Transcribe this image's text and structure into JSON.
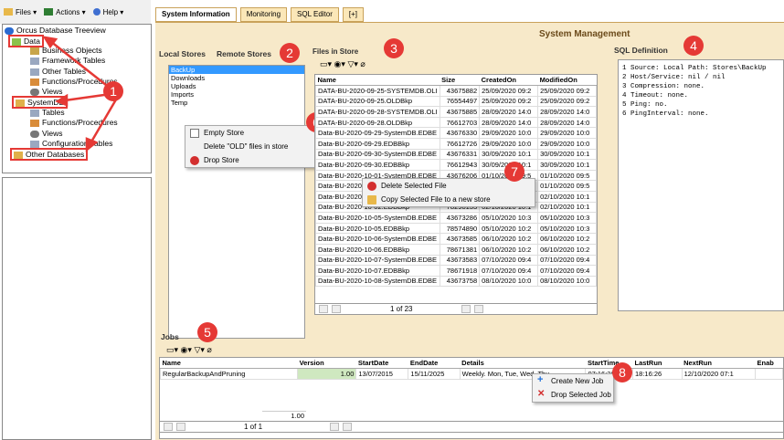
{
  "toolbar": {
    "files": "Files",
    "actions": "Actions",
    "help": "Help"
  },
  "tree": {
    "root": "Orcus Database Treeview",
    "items": [
      "Data",
      "Business Objects",
      "Framework Tables",
      "Other Tables",
      "Functions/Procedures",
      "Views",
      "SystemDB",
      "Tables",
      "Functions/Procedures",
      "Views",
      "Configuration Tables",
      "Other Databases"
    ]
  },
  "tabs": [
    "System Information",
    "Monitoring",
    "SQL Editor",
    "[+]"
  ],
  "title": "System Management",
  "stores": {
    "local_tab": "Local Stores",
    "remote_tab": "Remote Stores",
    "items": [
      "BackUp",
      "Downloads",
      "Uploads",
      "Imports",
      "Temp"
    ]
  },
  "store_menu": [
    "Empty Store",
    "Delete \"OLD\" files in store",
    "Drop Store"
  ],
  "files": {
    "title": "Files in Store",
    "headers": [
      "Name",
      "Size",
      "CreatedOn",
      "ModifiedOn"
    ],
    "rows": [
      [
        "DATA-BU-2020-09-25-SYSTEMDB.OLI",
        "43675882",
        "25/09/2020 09:2",
        "25/09/2020 09:2"
      ],
      [
        "DATA-BU-2020-09-25.OLDBkp",
        "76554497",
        "25/09/2020 09:2",
        "25/09/2020 09:2"
      ],
      [
        "DATA-BU-2020-09-28-SYSTEMDB.OLI",
        "43675885",
        "28/09/2020 14:0",
        "28/09/2020 14:0"
      ],
      [
        "DATA-BU-2020-09-28.OLDBkp",
        "76612703",
        "28/09/2020 14:0",
        "28/09/2020 14:0"
      ],
      [
        "Data-BU-2020-09-29-SystemDB.EDBE",
        "43676330",
        "29/09/2020 10:0",
        "29/09/2020 10:0"
      ],
      [
        "Data-BU-2020-09-29.EDBBkp",
        "76612726",
        "29/09/2020 10:0",
        "29/09/2020 10:0"
      ],
      [
        "Data-BU-2020-09-30-SystemDB.EDBE",
        "43676331",
        "30/09/2020 10:1",
        "30/09/2020 10:1"
      ],
      [
        "Data-BU-2020-09-30.EDBBkp",
        "76612943",
        "30/09/2020 10:1",
        "30/09/2020 10:1"
      ],
      [
        "Data-BU-2020-10-01-SystemDB.EDBE",
        "43676206",
        "01/10/2020 09:5",
        "01/10/2020 09:5"
      ],
      [
        "Data-BU-2020-10-01.EDBBkp",
        "78296017",
        "01/10/2020 09:5",
        "01/10/2020 09:5"
      ],
      [
        "Data-BU-2020-10-02-SystemDB.EDBE",
        "43676326",
        "02/10/2020 10:1",
        "02/10/2020 10:1"
      ],
      [
        "Data-BU-2020-10-02.EDBBkp",
        "78298133",
        "02/10/2020 10:1",
        "02/10/2020 10:1"
      ],
      [
        "Data-BU-2020-10-05-SystemDB.EDBE",
        "43673286",
        "05/10/2020 10:3",
        "05/10/2020 10:3"
      ],
      [
        "Data-BU-2020-10-05.EDBBkp",
        "78574890",
        "05/10/2020 10:2",
        "05/10/2020 10:3"
      ],
      [
        "Data-BU-2020-10-06-SystemDB.EDBE",
        "43673585",
        "06/10/2020 10:2",
        "06/10/2020 10:2"
      ],
      [
        "Data-BU-2020-10-06.EDBBkp",
        "78671381",
        "06/10/2020 10:2",
        "06/10/2020 10:2"
      ],
      [
        "Data-BU-2020-10-07-SystemDB.EDBE",
        "43673583",
        "07/10/2020 09:4",
        "07/10/2020 09:4"
      ],
      [
        "Data-BU-2020-10-07.EDBBkp",
        "78671918",
        "07/10/2020 09:4",
        "07/10/2020 09:4"
      ],
      [
        "Data-BU-2020-10-08-SystemDB.EDBE",
        "43673758",
        "08/10/2020 10:0",
        "08/10/2020 10:0"
      ]
    ],
    "pager": "1 of 23"
  },
  "file_menu": [
    "Delete Selected File",
    "Copy Selected File to a new store"
  ],
  "sql": {
    "title": "SQL Definition",
    "lines": [
      "1 Source: Local Path: Stores\\BackUp",
      "2 Host/Service: nil / nil",
      "3 Compression: none.",
      "4 Timeout: none.",
      "5 Ping: no.",
      "6 PingInterval: none."
    ]
  },
  "jobs": {
    "title": "Jobs",
    "headers": [
      "Name",
      "Version",
      "StartDate",
      "EndDate",
      "Details",
      "StartTime",
      "LastRun",
      "NextRun",
      "Enab"
    ],
    "row": [
      "RegularBackupAndPruning",
      "1.00",
      "13/07/2015",
      "15/11/2025",
      "Weekly. Mon, Tue, Wed, Thu,",
      "07:16:26",
      "18:16:26",
      "12/10/2020 07:1",
      ""
    ],
    "total": "1.00",
    "pager": "1 of 1"
  },
  "job_menu": [
    "Create New Job",
    "Drop Selected Job"
  ],
  "badges": [
    "1",
    "2",
    "3",
    "4",
    "5",
    "6",
    "7",
    "8"
  ]
}
